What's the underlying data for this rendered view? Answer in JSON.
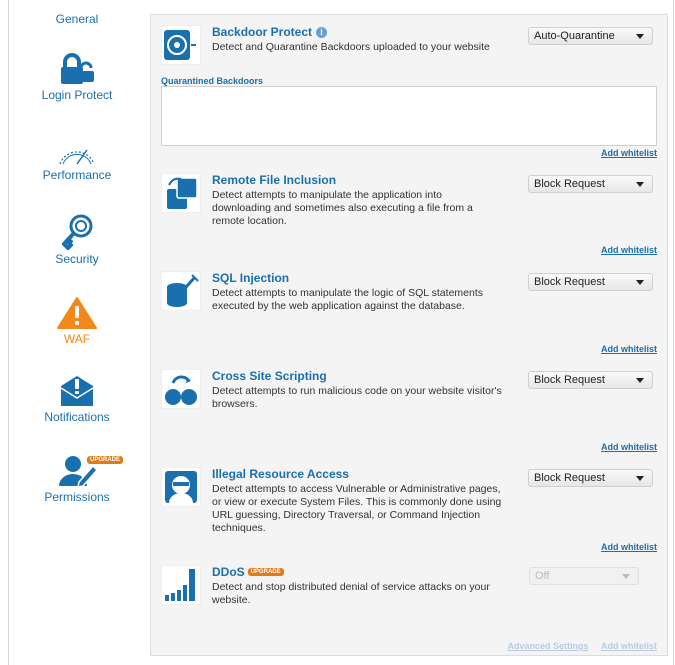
{
  "sidebar": {
    "items": [
      {
        "label": "General",
        "icon": "general-icon"
      },
      {
        "label": "Login Protect",
        "icon": "lock-icon"
      },
      {
        "label": "Performance",
        "icon": "speedometer-icon"
      },
      {
        "label": "Security",
        "icon": "key-icon"
      },
      {
        "label": "WAF",
        "icon": "warning-triangle-icon",
        "active": true
      },
      {
        "label": "Notifications",
        "icon": "notification-icon"
      },
      {
        "label": "Permissions",
        "icon": "user-pencil-icon",
        "badge": "UPGRADE"
      }
    ]
  },
  "features": {
    "backdoor": {
      "title": "Backdoor Protect",
      "info_icon": "info-icon",
      "description": "Detect and Quarantine Backdoors uploaded to your website",
      "select": "Auto-Quarantine",
      "quarantine_label": "Quarantined Backdoors",
      "whitelist": "Add whitelist"
    },
    "rfi": {
      "title": "Remote File Inclusion",
      "description": "Detect attempts to manipulate the application into downloading and sometimes also executing a file from a remote location.",
      "select": "Block Request",
      "whitelist": "Add whitelist"
    },
    "sqli": {
      "title": "SQL Injection",
      "description": "Detect attempts to manipulate the logic of SQL statements executed by the web application against the database.",
      "select": "Block Request",
      "whitelist": "Add whitelist"
    },
    "xss": {
      "title": "Cross Site Scripting",
      "description": "Detect attempts to run malicious code on your website visitor's browsers.",
      "select": "Block Request",
      "whitelist": "Add whitelist"
    },
    "ira": {
      "title": "Illegal Resource Access",
      "description": "Detect attempts to access Vulnerable or Administrative pages, or view or execute System Files. This is commonly done using URL guessing, Directory Traversal, or Command Injection techniques.",
      "select": "Block Request",
      "whitelist": "Add whitelist"
    },
    "ddos": {
      "title": "DDoS",
      "badge": "UPGRADE",
      "description": "Detect and stop distributed denial of service attacks on your website.",
      "select": "Off",
      "advanced": "Advanced Settings",
      "whitelist": "Add whitelist"
    }
  },
  "colors": {
    "link": "#1a6faf",
    "active": "#f0891a",
    "panel_bg": "#f4f4f4",
    "icon_blue": "#1a6faf"
  }
}
